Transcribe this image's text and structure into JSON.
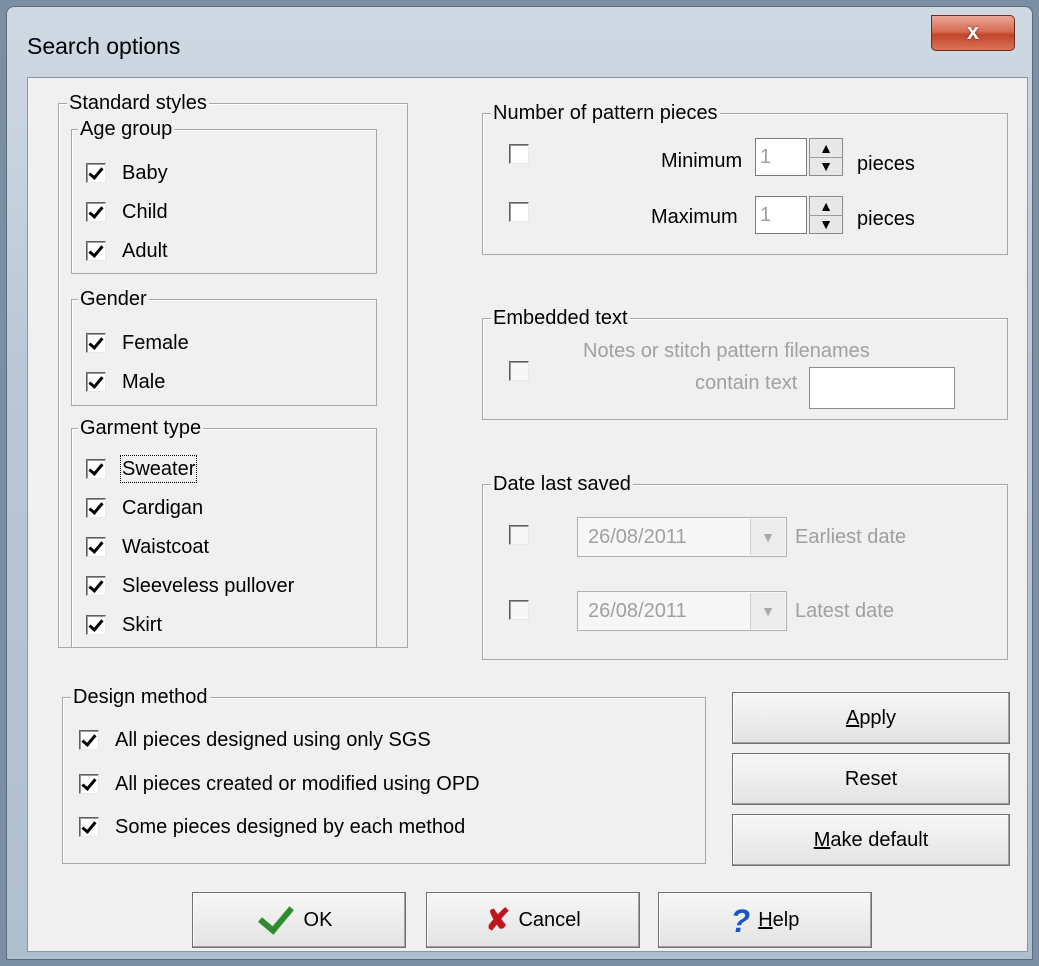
{
  "window": {
    "title": "Search options",
    "close_label": "x"
  },
  "standard_styles": {
    "label": "Standard styles",
    "age_group": {
      "label": "Age group",
      "items": [
        {
          "label": "Baby",
          "checked": true
        },
        {
          "label": "Child",
          "checked": true
        },
        {
          "label": "Adult",
          "checked": true
        }
      ]
    },
    "gender": {
      "label": "Gender",
      "items": [
        {
          "label": "Female",
          "checked": true
        },
        {
          "label": "Male",
          "checked": true
        }
      ]
    },
    "garment_type": {
      "label": "Garment type",
      "items": [
        {
          "label": "Sweater",
          "checked": true
        },
        {
          "label": "Cardigan",
          "checked": true
        },
        {
          "label": "Waistcoat",
          "checked": true
        },
        {
          "label": "Sleeveless pullover",
          "checked": true
        },
        {
          "label": "Skirt",
          "checked": true
        }
      ]
    }
  },
  "pattern_pieces": {
    "label": "Number of pattern pieces",
    "minimum": {
      "label": "Minimum",
      "value": "1",
      "unit": "pieces",
      "checked": false
    },
    "maximum": {
      "label": "Maximum",
      "value": "1",
      "unit": "pieces",
      "checked": false
    }
  },
  "embedded_text": {
    "label": "Embedded text",
    "line1": "Notes or stitch pattern filenames",
    "line2": "contain text",
    "value": "",
    "checked": false
  },
  "date_last_saved": {
    "label": "Date last saved",
    "earliest": {
      "value": "26/08/2011",
      "label": "Earliest date",
      "checked": false
    },
    "latest": {
      "value": "26/08/2011",
      "label": "Latest date",
      "checked": false
    }
  },
  "design_method": {
    "label": "Design method",
    "items": [
      {
        "label": "All pieces designed using only SGS",
        "checked": true
      },
      {
        "label": "All pieces created or modified using OPD",
        "checked": true
      },
      {
        "label": "Some pieces designed by each method",
        "checked": true
      }
    ]
  },
  "buttons": {
    "apply_first": "A",
    "apply_rest": "pply",
    "reset": "Reset",
    "make_default_first": "M",
    "make_default_rest": "ake default",
    "ok": "OK",
    "cancel": "Cancel",
    "help_first": "H",
    "help_rest": "elp"
  },
  "icons": {
    "ok": "green-checkmark-icon",
    "cancel": "red-x-icon",
    "help": "blue-question-icon"
  },
  "colors": {
    "ok_icon": "#2e8b2e",
    "cancel_icon": "#c0161b",
    "help_icon": "#1a55c9",
    "close_button": "#c2452b"
  }
}
